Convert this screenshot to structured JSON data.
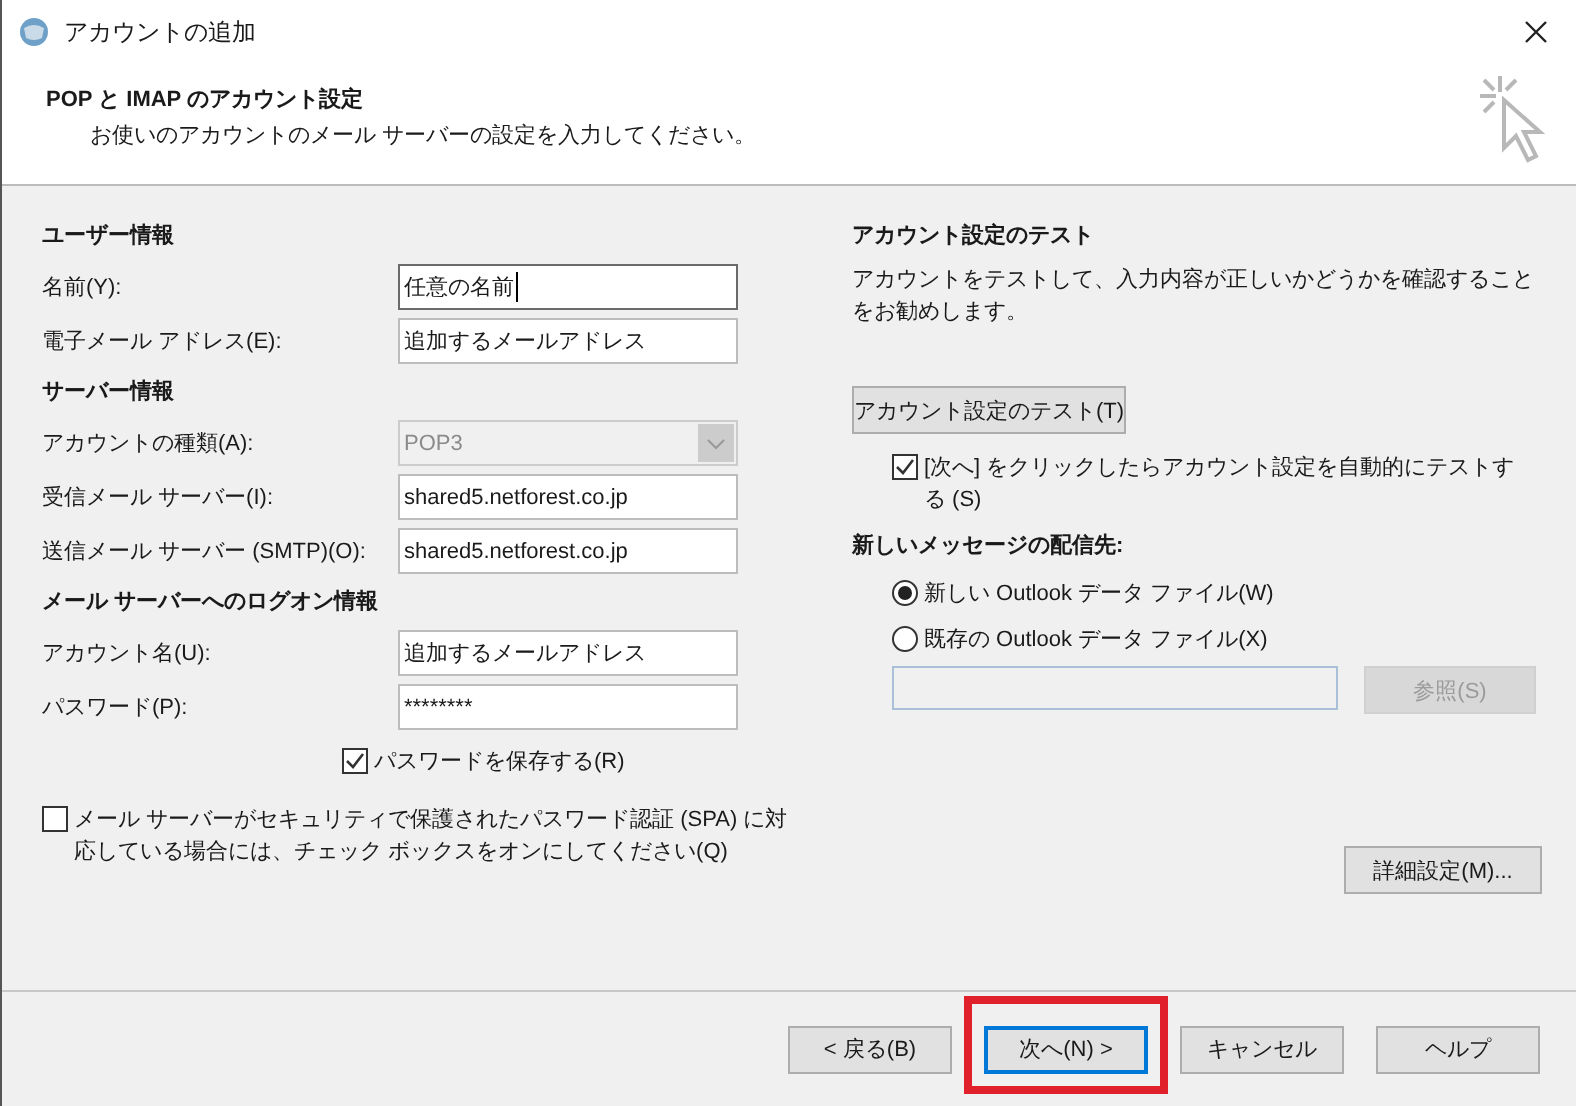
{
  "window": {
    "title": "アカウントの追加"
  },
  "header": {
    "title": "POP と IMAP のアカウント設定",
    "subtitle": "お使いのアカウントのメール サーバーの設定を入力してください。"
  },
  "sections": [
    {
      "heading": "ユーザー情報",
      "fields": [
        {
          "kind": "text",
          "label": "名前(Y):",
          "value": "任意の名前",
          "focused": true
        },
        {
          "kind": "text",
          "label": "電子メール アドレス(E):",
          "value": "追加するメールアドレス",
          "focused": false
        }
      ]
    },
    {
      "heading": "サーバー情報",
      "fields": [
        {
          "kind": "dropdown",
          "label": "アカウントの種類(A):",
          "value": "POP3",
          "focused": false
        },
        {
          "kind": "text",
          "label": "受信メール サーバー(I):",
          "value": "shared5.netforest.co.jp",
          "focused": false
        },
        {
          "kind": "text",
          "label": "送信メール サーバー (SMTP)(O):",
          "value": "shared5.netforest.co.jp",
          "focused": false
        }
      ]
    },
    {
      "heading": "メール サーバーへのログオン情報",
      "fields": [
        {
          "kind": "text",
          "label": "アカウント名(U):",
          "value": "追加するメールアドレス",
          "focused": false
        },
        {
          "kind": "text",
          "label": "パスワード(P):",
          "value": "********",
          "focused": false
        }
      ]
    }
  ],
  "save_password": {
    "label": "パスワードを保存する(R)",
    "checked": true
  },
  "spa": {
    "label": "メール サーバーがセキュリティで保護されたパスワード認証 (SPA) に対応している場合には、チェック ボックスをオンにしてください(Q)",
    "checked": false
  },
  "test": {
    "heading": "アカウント設定のテスト",
    "description": "アカウントをテストして、入力内容が正しいかどうかを確認することをお勧めします。",
    "button": "アカウント設定のテスト(T)",
    "auto_test": {
      "label": "[次へ] をクリックしたらアカウント設定を自動的にテストする (S)",
      "checked": true
    }
  },
  "delivery": {
    "heading": "新しいメッセージの配信先:",
    "options": [
      {
        "label": "新しい Outlook データ ファイル(W)",
        "selected": true
      },
      {
        "label": "既存の Outlook データ ファイル(X)",
        "selected": false
      }
    ],
    "browse": {
      "label": "参照(S)",
      "disabled": true
    }
  },
  "advanced_button": "詳細設定(M)...",
  "footer_buttons": [
    {
      "label": "< 戻る(B)",
      "default": false,
      "highlighted": false
    },
    {
      "label": "次へ(N) >",
      "default": true,
      "highlighted": true
    },
    {
      "label": "キャンセル",
      "default": false,
      "highlighted": false
    },
    {
      "label": "ヘルプ",
      "default": false,
      "highlighted": false
    }
  ]
}
